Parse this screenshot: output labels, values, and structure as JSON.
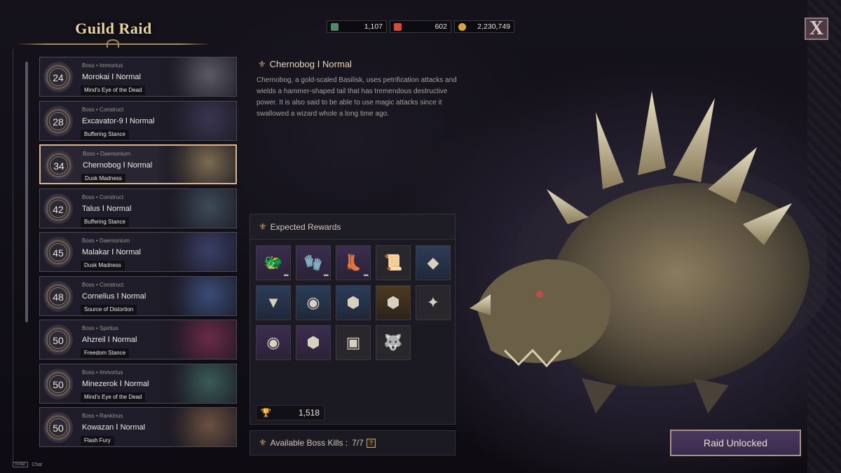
{
  "header": {
    "title": "Guild Raid",
    "close_label": "X"
  },
  "currencies": [
    {
      "name": "currency-1",
      "value": "1,107",
      "color": "#4f8b6a"
    },
    {
      "name": "currency-2",
      "value": "602",
      "color": "#d44b3a"
    },
    {
      "name": "currency-3",
      "value": "2,230,749",
      "color": "#d4a63c"
    }
  ],
  "raids": [
    {
      "type": "Boss • Immortus",
      "name": "Morokai Ⅰ Normal",
      "stance": "Mind's Eye of the Dead",
      "level": "24",
      "selected": false,
      "tint": "#5b5a64"
    },
    {
      "type": "Boss • Construct",
      "name": "Excavator-9 Ⅰ Normal",
      "stance": "Buffering Stance",
      "level": "28",
      "selected": false,
      "tint": "#3a3550"
    },
    {
      "type": "Boss • Daemonium",
      "name": "Chernobog Ⅰ Normal",
      "stance": "Dusk Madness",
      "level": "34",
      "selected": true,
      "tint": "#7a6a50"
    },
    {
      "type": "Boss • Construct",
      "name": "Talus Ⅰ Normal",
      "stance": "Buffering Stance",
      "level": "42",
      "selected": false,
      "tint": "#3d4a58"
    },
    {
      "type": "Boss • Daemonium",
      "name": "Malakar Ⅰ Normal",
      "stance": "Dusk Madness",
      "level": "45",
      "selected": false,
      "tint": "#3a3f66"
    },
    {
      "type": "Boss • Construct",
      "name": "Cornelius Ⅰ Normal",
      "stance": "Source of Distortion",
      "level": "48",
      "selected": false,
      "tint": "#3a4c78"
    },
    {
      "type": "Boss • Spiritus",
      "name": "Ahzreil Ⅰ Normal",
      "stance": "Freedom Stance",
      "level": "50",
      "selected": false,
      "tint": "#6a2a48"
    },
    {
      "type": "Boss • Immortus",
      "name": "Minezerok Ⅰ Normal",
      "stance": "Mind's Eye of the Dead",
      "level": "50",
      "selected": false,
      "tint": "#3a5a58"
    },
    {
      "type": "Boss • Rankinus",
      "name": "Kowazan Ⅰ Normal",
      "stance": "Flash Fury",
      "level": "50",
      "selected": false,
      "tint": "#6a5040"
    }
  ],
  "info": {
    "title": "Chernobog Ⅰ Normal",
    "description": "Chernobog, a gold-scaled Basilisk, uses petrification attacks and wields a hammer-shaped tail that has tremendous destructive power. It is also said to be able to use magic attacks since it swallowed a wizard whole a long time ago."
  },
  "rewards": {
    "title": "Expected Rewards",
    "items": [
      {
        "name": "dragon-helm-icon",
        "bg": "purple",
        "glyph": "🐲",
        "dots": true
      },
      {
        "name": "dark-gloves-icon",
        "bg": "purple",
        "glyph": "🧤",
        "dots": true
      },
      {
        "name": "boots-icon",
        "bg": "purple",
        "glyph": "👢",
        "dots": true
      },
      {
        "name": "scroll-icon",
        "bg": "dark",
        "glyph": "📜",
        "dots": false
      },
      {
        "name": "orange-crystal-icon",
        "bg": "blue",
        "glyph": "◆",
        "dots": false
      },
      {
        "name": "blue-triangle-gem-icon",
        "bg": "blue",
        "glyph": "▼",
        "dots": false
      },
      {
        "name": "blue-orb-icon",
        "bg": "blue",
        "glyph": "◉",
        "dots": false
      },
      {
        "name": "silver-hexagon-icon",
        "bg": "blue",
        "glyph": "⬢",
        "dots": false
      },
      {
        "name": "orange-hexagon-icon",
        "bg": "gold",
        "glyph": "⬢",
        "dots": false
      },
      {
        "name": "gold-star-gem-icon",
        "bg": "dark",
        "glyph": "✦",
        "dots": false
      },
      {
        "name": "blue-crystal-orb-icon",
        "bg": "purple",
        "glyph": "◉",
        "dots": false
      },
      {
        "name": "silver-shard-icon",
        "bg": "purple",
        "glyph": "⬢",
        "dots": false
      },
      {
        "name": "green-rune-icon",
        "bg": "dark",
        "glyph": "▣",
        "dots": false
      },
      {
        "name": "wolf-icon",
        "bg": "dark",
        "glyph": "🐺",
        "dots": false
      }
    ],
    "score": "1,518"
  },
  "kills": {
    "label": "Available Boss Kills :",
    "value": "7/7",
    "help": "?"
  },
  "raid_button": "Raid Unlocked",
  "chat": {
    "key": "Enter",
    "label": "Chat"
  }
}
